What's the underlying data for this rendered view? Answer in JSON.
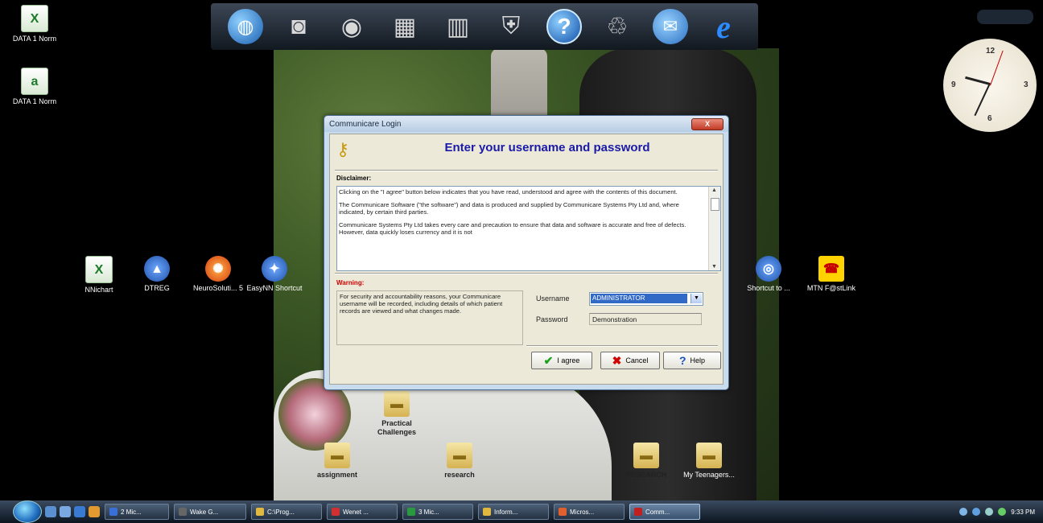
{
  "dock": {
    "icons": [
      "globe-icon",
      "camera-icon",
      "speaker-icon",
      "film-icon",
      "pen-cup-icon",
      "shield-icon",
      "help-icon",
      "recycle-bin-icon",
      "mail-icon",
      "internet-explorer-icon"
    ]
  },
  "desktop": {
    "icons": [
      {
        "name": "data1-excel",
        "label": "DATA 1 Norm"
      },
      {
        "name": "data1-doc",
        "label": "DATA 1 Norm"
      },
      {
        "name": "nnichart",
        "label": "NNichart"
      },
      {
        "name": "dtreg",
        "label": "DTREG"
      },
      {
        "name": "neurosolutions",
        "label": "NeuroSoluti... 5"
      },
      {
        "name": "easynn",
        "label": "EasyNN Shortcut"
      },
      {
        "name": "shortcut",
        "label": "Shortcut to ..."
      },
      {
        "name": "mtn",
        "label": "MTN F@stLink"
      },
      {
        "name": "practical-challenges",
        "label": "Practical Challenges"
      },
      {
        "name": "assignment",
        "label": "assignment"
      },
      {
        "name": "research",
        "label": "research"
      },
      {
        "name": "research-2",
        "label": "RESEARCH"
      },
      {
        "name": "my-teenagers",
        "label": "My Teenagers..."
      }
    ]
  },
  "dialog": {
    "title": "Communicare Login",
    "close_label": "X",
    "heading": "Enter your username and password",
    "disclaimer_label": "Disclaimer:",
    "disclaimer_paragraphs": [
      "Clicking on the \"I agree\" button below indicates that you have read, understood and agree with the contents of this document.",
      "The Communicare Software (\"the software\") and data is produced and supplied by Communicare Systems Pty Ltd and, where indicated, by certain third parties.",
      "Communicare Systems Pty Ltd takes every care and precaution to ensure that data and software is accurate and free of defects. However, data quickly loses currency and it is not"
    ],
    "warning_label": "Warning:",
    "warning_text": "For security and accountability reasons, your Communicare username will be recorded, including details of which patient records are viewed and what changes made.",
    "username_label": "Username",
    "username_value": "ADMINISTRATOR",
    "password_label": "Password",
    "password_value": "Demonstration",
    "agree_label": "I agree",
    "cancel_label": "Cancel",
    "help_label": "Help"
  },
  "taskbar": {
    "buttons": [
      "2 Mic...",
      "Wake G...",
      "C:\\Prog...",
      "Wenet ...",
      "3 Mic...",
      "Inform...",
      "Micros...",
      "Comm..."
    ],
    "clock": "9:33 PM"
  },
  "colors": {
    "heading": "#1a1aa8",
    "warning": "#d00000",
    "selection": "#3169c6"
  }
}
